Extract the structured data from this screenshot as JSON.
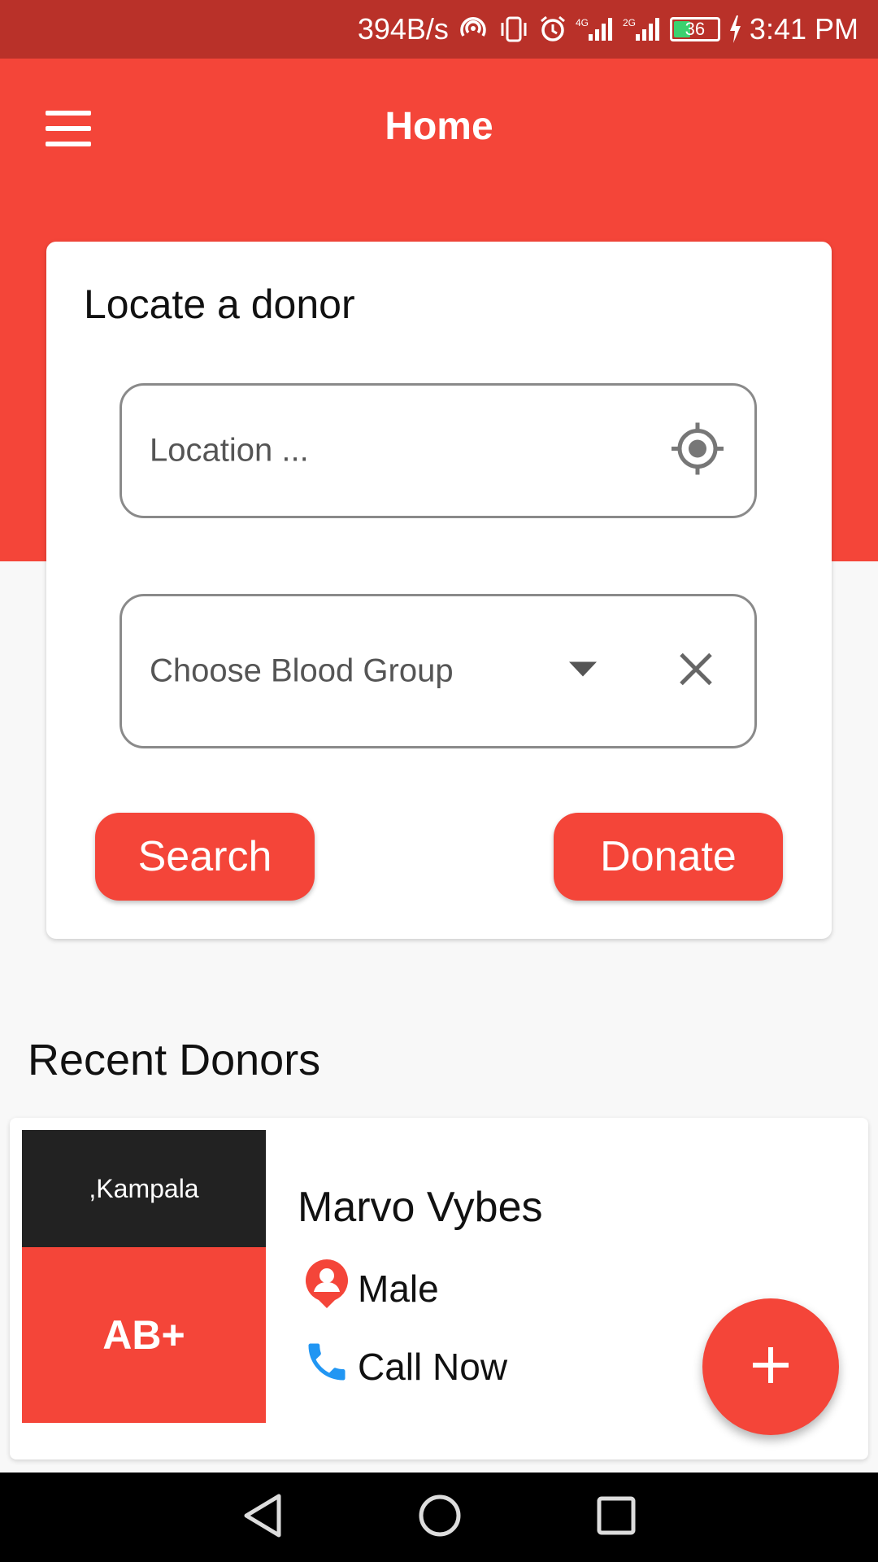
{
  "status_bar": {
    "speed": "394B/s",
    "battery": "36",
    "time": "3:41 PM",
    "icons": [
      "hotspot-icon",
      "vibrate-icon",
      "alarm-icon",
      "4g-signal-icon",
      "2g-signal-icon",
      "battery-icon",
      "charging-icon"
    ]
  },
  "app_bar": {
    "title": "Home",
    "menu_icon": "menu-icon"
  },
  "locate": {
    "title": "Locate a donor",
    "location_placeholder": "Location ...",
    "blood_group_placeholder": "Choose Blood Group",
    "search_label": "Search",
    "donate_label": "Donate"
  },
  "recent": {
    "title": "Recent Donors",
    "donors": [
      {
        "location": ",Kampala",
        "blood_group": "AB+",
        "name": "Marvo Vybes",
        "gender": "Male",
        "call_label": "Call Now"
      }
    ]
  },
  "colors": {
    "primary": "#f44539",
    "status_bar": "#b93129",
    "phone_icon": "#2196f3"
  }
}
